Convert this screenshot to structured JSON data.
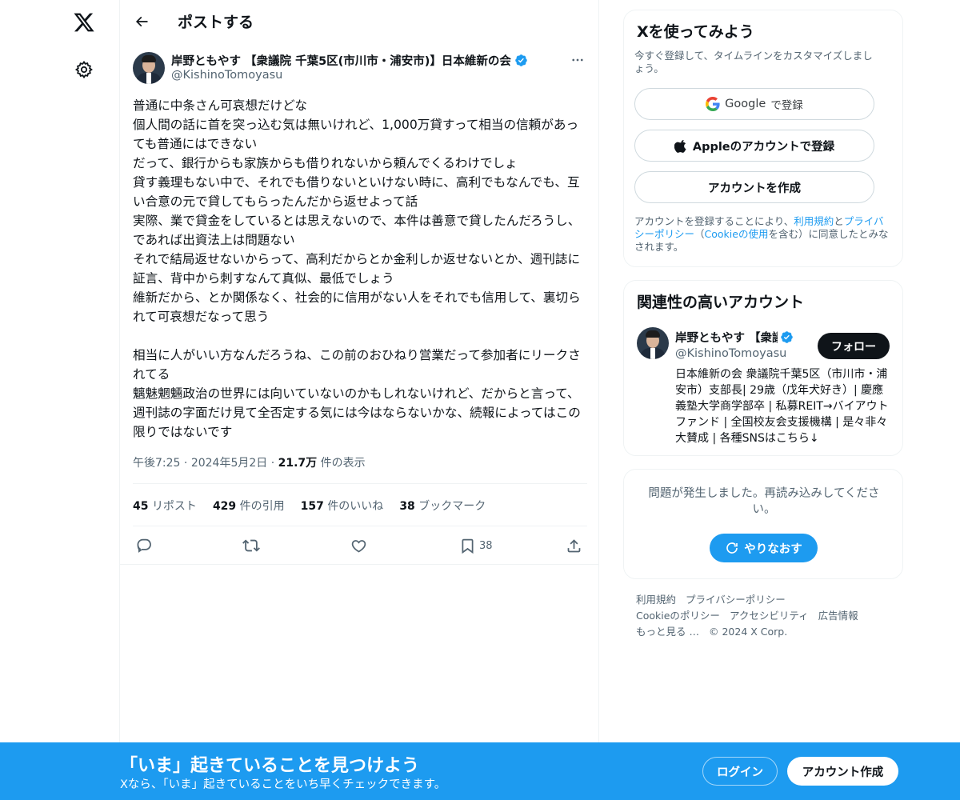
{
  "header": {
    "title": "ポストする"
  },
  "tweet": {
    "author_name": "岸野ともやす 【衆議院 千葉5区(市川市・浦安市)】日本維新の会",
    "author_handle": "@KishinoTomoyasu",
    "text": "普通に中条さん可哀想だけどな\n個人間の話に首を突っ込む気は無いけれど、1,000万貸すって相当の信頼があっても普通にはできない\nだって、銀行からも家族からも借りれないから頼んでくるわけでしょ\n貸す義理もない中で、それでも借りないといけない時に、高利でもなんでも、互い合意の元で貸してもらったんだから返せよって話\n実際、業で貸金をしているとは思えないので、本件は善意で貸したんだろうし、であれば出資法上は問題ない\nそれで結局返せないからって、高利だからとか金利しか返せないとか、週刊誌に証言、背中から刺すなんて真似、最低でしょう\n維新だから、とか関係なく、社会的に信用がない人をそれでも信用して、裏切られて可哀想だなって思う\n\n相当に人がいい方なんだろうね、この前のおひねり営業だって参加者にリークされてる\n魑魅魍魎政治の世界には向いていないのかもしれないけれど、だからと言って、週刊誌の字面だけ見て全否定する気には今はならないかな、続報によってはこの限りではないです",
    "time": "午後7:25",
    "date": "2024年5月2日",
    "views_count": "21.7万",
    "views_label": "件の表示",
    "reposts_count": "45",
    "reposts_label": "リポスト",
    "quotes_count": "429",
    "quotes_label": "件の引用",
    "likes_count": "157",
    "likes_label": "件のいいね",
    "bookmarks_count": "38",
    "bookmarks_label": "ブックマーク",
    "bookmark_action_count": "38"
  },
  "signup_card": {
    "title": "Xを使ってみよう",
    "subtitle": "今すぐ登録して、タイムラインをカスタマイズしましょう。",
    "google_brand": "Google",
    "google_suffix": "で登録",
    "apple_label": "Appleのアカウントで登録",
    "create_label": "アカウントを作成",
    "legal_prefix": "アカウントを登録することにより、",
    "legal_terms": "利用規約",
    "legal_and": "と",
    "legal_privacy": "プライバシーポリシー",
    "legal_open": "（",
    "legal_cookie": "Cookieの使用",
    "legal_suffix": "を含む）に同意したとみなされます。"
  },
  "related": {
    "title": "関連性の高いアカウント",
    "name": "岸野ともやす 【衆議院",
    "handle": "@KishinoTomoyasu",
    "follow_label": "フォロー",
    "bio": "日本維新の会 衆議院千葉5区（市川市・浦安市）支部長| 29歳（戊年犬好き）| 慶應義塾大学商学部卒 | 私募REIT→バイアウトファンド | 全国校友会支援機構 | 是々非々大賛成 | 各種SNSはこちら↓"
  },
  "error_card": {
    "message": "問題が発生しました。再読み込みしてください。",
    "retry_label": "やりなおす"
  },
  "footer": {
    "terms": "利用規約",
    "privacy": "プライバシーポリシー",
    "cookie": "Cookieのポリシー",
    "accessibility": "アクセシビリティ",
    "ads": "広告情報",
    "more": "もっと見る …",
    "copyright": "© 2024 X Corp."
  },
  "banner": {
    "title": "「いま」起きていることを見つけよう",
    "subtitle": "Xなら、「いま」起きていることをいち早くチェックできます。",
    "login_label": "ログイン",
    "signup_label": "アカウント作成"
  },
  "colors": {
    "accent": "#1d9bf0",
    "text": "#0f1419",
    "muted": "#536471"
  }
}
